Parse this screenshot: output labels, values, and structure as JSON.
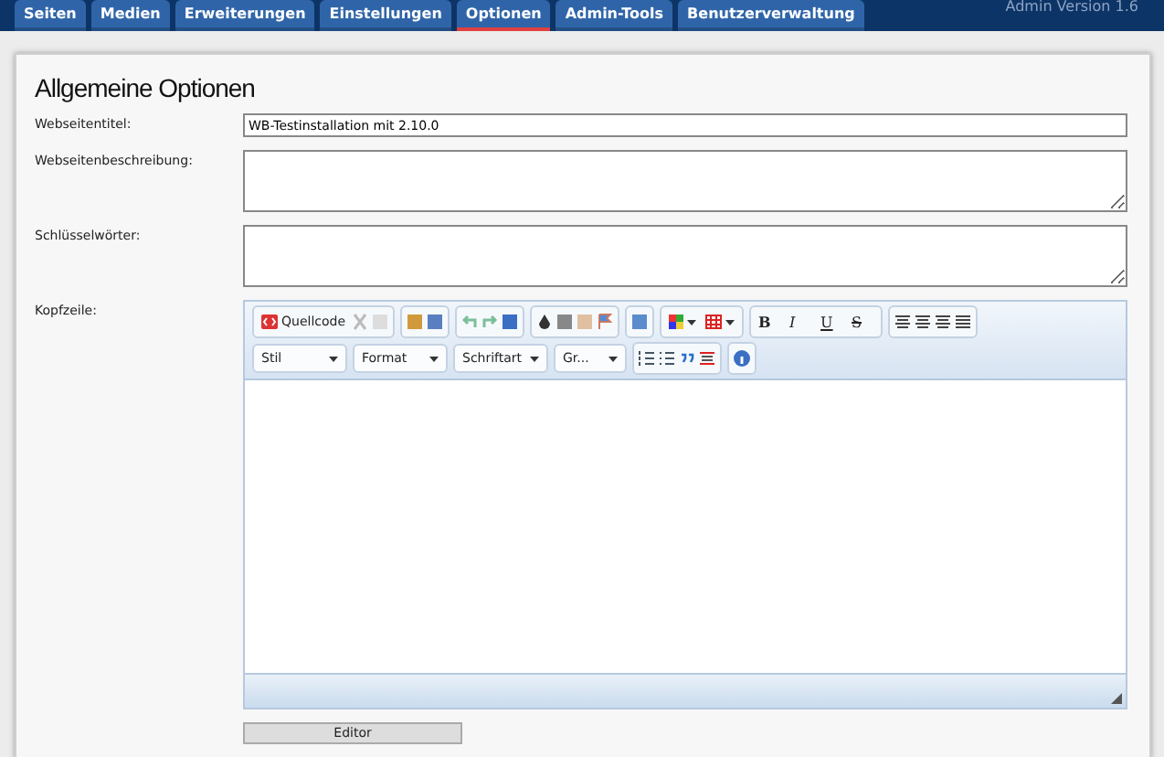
{
  "header": {
    "version": "Admin Version 1.6"
  },
  "tabs": [
    {
      "label": "Seiten",
      "selected": false
    },
    {
      "label": "Medien",
      "selected": false
    },
    {
      "label": "Erweiterungen",
      "selected": false
    },
    {
      "label": "Einstellungen",
      "selected": false
    },
    {
      "label": "Optionen",
      "selected": true
    },
    {
      "label": "Admin-Tools",
      "selected": false
    },
    {
      "label": "Benutzerverwaltung",
      "selected": false
    }
  ],
  "section_title": "Allgemeine Optionen",
  "fields": [
    {
      "label": "Webseitentitel:",
      "kind": "text",
      "value": "WB-Testinstallation mit 2.10.0"
    },
    {
      "label": "Webseitenbeschreibung:",
      "kind": "textarea"
    },
    {
      "label": "Schlüsselwörter:",
      "kind": "textarea"
    }
  ],
  "editor": {
    "label": "Kopfzeile:",
    "source_button": "Quellcode",
    "format_buttons": [
      "B",
      "I",
      "U",
      "S"
    ],
    "dropdowns": [
      "Stil",
      "Format",
      "Schriftart",
      "Gr..."
    ],
    "toggle_button": "Editor"
  }
}
